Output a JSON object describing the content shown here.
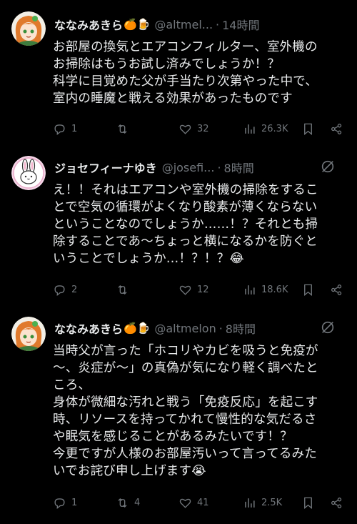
{
  "tweets": [
    {
      "name": "ななみあきら",
      "emojis": "🍊🍺",
      "handle": "@altmel...",
      "time": "14時間",
      "text": "お部屋の換気とエアコンフィルター、室外機の\nお掃除はもうお試し済みでしょうか！？\n科学に目覚めた父が手当たり次第やった中で、\n室内の睡魔と戦える効果があったものです",
      "replies": "1",
      "retweets": "",
      "likes": "32",
      "views": "26.3K"
    },
    {
      "name": "ジョセフィーナゆき",
      "emojis": "",
      "handle": "@josefi...",
      "time": "8時間",
      "text": "え！！それはエアコンや室外機の掃除をするこ\nとで空気の循環がよくなり酸素が薄くならない\nということなのでしょうか……！？それとも掃\n除することであ〜ちょっと横になるかを防ぐと\nいうことでしょうか…！？！？😂",
      "replies": "2",
      "retweets": "",
      "likes": "12",
      "views": "18.6K"
    },
    {
      "name": "ななみあきら",
      "emojis": "🍊🍺",
      "handle": "@altmelon",
      "time": "8時間",
      "text": "当時父が言った「ホコリやカビを吸うと免疫が\n〜、炎症が〜」の真偽が気になり軽く調べたと\nころ、\n身体が微細な汚れと戦う「免疫反応」を起こす\n時、リソースを持ってかれて慢性的な気だるさ\nや眠気を感じることがあるみたいです！？\n今更ですが人様のお部屋汚いって言ってるみた\nいでお詫び申し上げます😭",
      "replies": "1",
      "retweets": "4",
      "likes": "41",
      "views": "2.5K"
    }
  ],
  "icons": {
    "reply": "reply-icon",
    "retweet": "retweet-icon",
    "like": "heart-icon",
    "views": "views-icon",
    "bookmark": "bookmark-icon",
    "share": "share-icon",
    "mute": "mute-icon"
  },
  "colors": {
    "background": "#000000",
    "text": "#e7e9ea",
    "muted": "#71767b",
    "avatar_akira_bg": "#f3a64e",
    "avatar_yuki_bg": "#f5d7e8"
  }
}
